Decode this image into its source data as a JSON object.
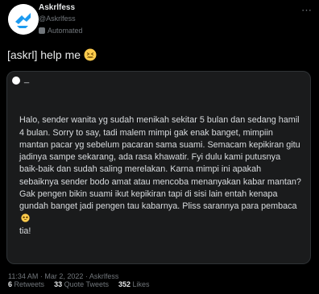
{
  "account": {
    "name": "Askrlfess",
    "handle": "@Askrlfess",
    "automated_label": "Automated",
    "avatar_icon": "logo-icon"
  },
  "tweet": {
    "text": "[askrl] help me",
    "emoji": "confounded-face-emoji"
  },
  "card": {
    "header_text": "_",
    "body": "Halo, sender wanita yg sudah menikah sekitar 5 bulan dan sedang hamil 4 bulan. Sorry to say, tadi malem mimpi gak enak banget, mimpiin mantan pacar yg sebelum pacaran sama suami. Semacam kepikiran gitu jadinya sampe sekarang, ada rasa khawatir. Fyi dulu kami putusnya baik-baik dan sudah saling merelakan. Karna mimpi ini apakah sebaiknya sender bodo amat atau mencoba menanyakan kabar mantan? Gak pengen bikin suami ikut kepikiran tapi di sisi lain entah kenapa gundah banget jadi pengen tau kabarnya. Pliss sarannya para pembaca",
    "body_end": "tia!"
  },
  "meta": {
    "text": "11:34 AM · Mar 2, 2022 · Askrlfess"
  },
  "stats": {
    "retweets_count": "6",
    "retweets_label": "Retweets",
    "quotes_count": "33",
    "quotes_label": "Quote Tweets",
    "likes_count": "352",
    "likes_label": "Likes"
  },
  "colors": {
    "background": "#000000",
    "text": "#e7e9ea",
    "muted": "#71767b",
    "card": "#1a1b1c"
  }
}
